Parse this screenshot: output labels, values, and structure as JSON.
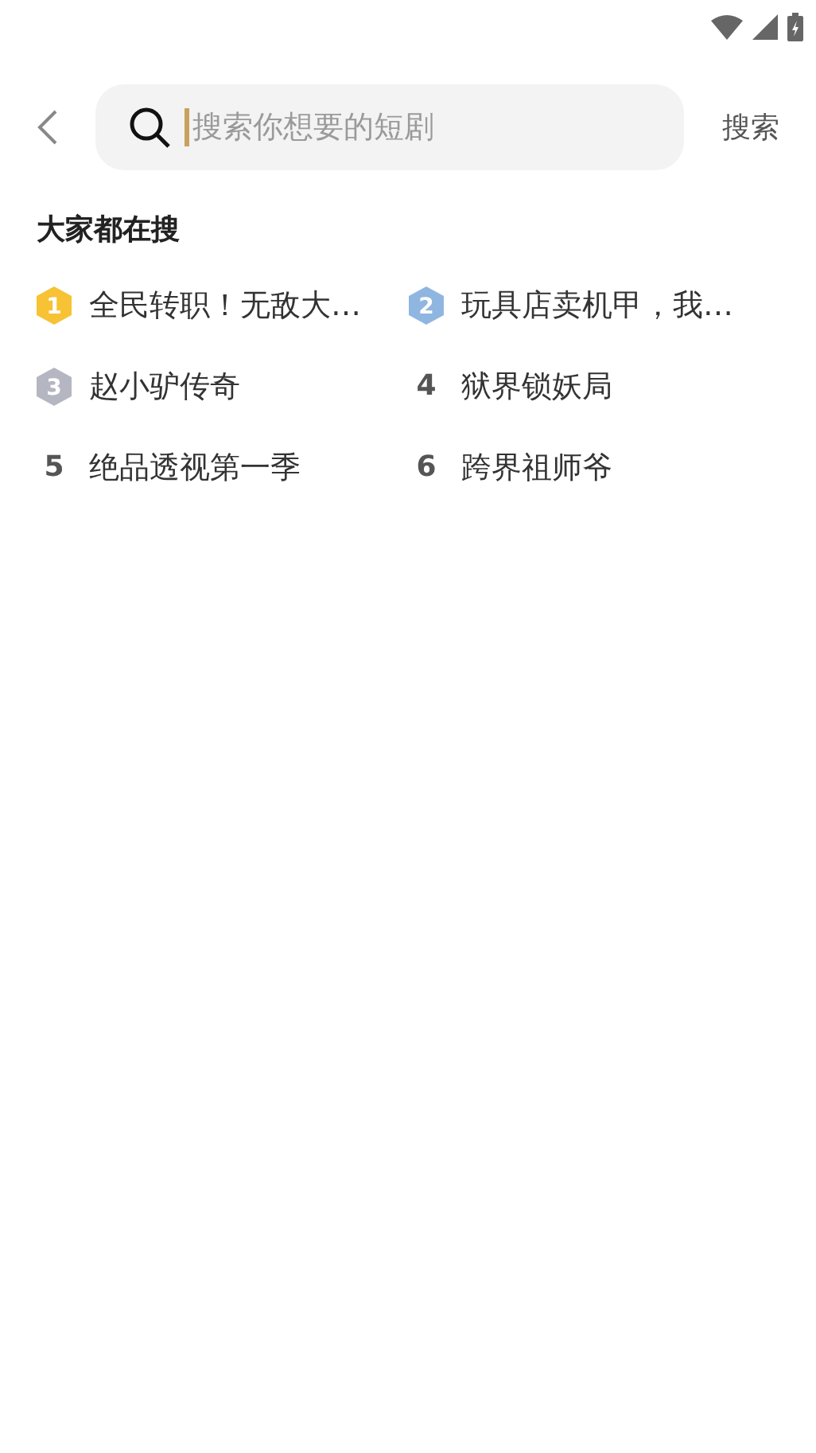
{
  "search": {
    "placeholder": "搜索你想要的短剧",
    "button": "搜索"
  },
  "section": {
    "title": "大家都在搜",
    "items": [
      {
        "rank": "1",
        "kind": "medal",
        "color": "#f7c234",
        "title": "全民转职！无敌大…"
      },
      {
        "rank": "2",
        "kind": "medal",
        "color": "#8fb6e0",
        "title": "玩具店卖机甲，我…"
      },
      {
        "rank": "3",
        "kind": "medal",
        "color": "#b4b6c2",
        "title": "赵小驴传奇"
      },
      {
        "rank": "4",
        "kind": "plain",
        "title": "狱界锁妖局"
      },
      {
        "rank": "5",
        "kind": "plain",
        "title": "绝品透视第一季"
      },
      {
        "rank": "6",
        "kind": "plain",
        "title": "跨界祖师爷"
      }
    ]
  }
}
